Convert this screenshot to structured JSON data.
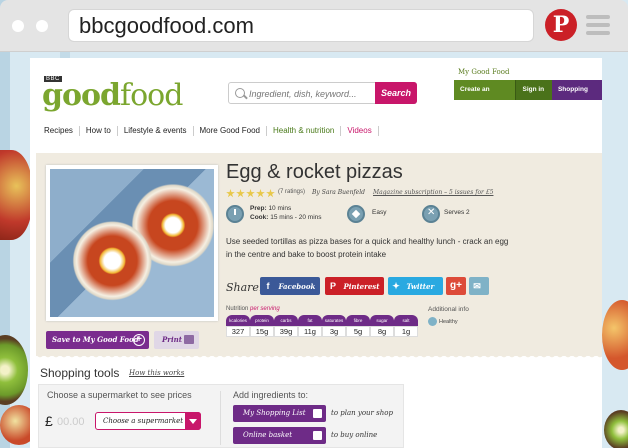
{
  "browser": {
    "url": "bbcgoodfood.com",
    "pinterest_glyph": "P"
  },
  "site": {
    "badge": "BBC",
    "logo_part1": "good",
    "logo_part2": "food",
    "search_placeholder": "Ingredient, dish, keyword...",
    "search_button": "Search",
    "my_good_food": "My Good Food",
    "create_account": "Create an account",
    "sign_in": "Sign in",
    "shopping_list": "Shopping List",
    "nav": [
      "Recipes",
      "How to",
      "Lifestyle & events",
      "More Good Food",
      "Health & nutrition",
      "Videos"
    ]
  },
  "recipe": {
    "title": "Egg & rocket pizzas",
    "ratings": "(7 ratings)",
    "author": "By Sara Buenfeld",
    "subscription": "Magazine subscription – 5 issues for £5",
    "prep_label": "Prep:",
    "prep_value": "10 mins",
    "cook_label": "Cook:",
    "cook_value": "15 mins - 20 mins",
    "skill": "Easy",
    "serves": "Serves 2",
    "description": "Use seeded tortillas as pizza bases for a quick and healthy lunch - crack an egg in the centre and bake to boost protein intake",
    "share_label": "Share:",
    "share": {
      "facebook": "Facebook",
      "pinterest": "Pinterest",
      "twitter": "Twitter",
      "googleplus": "g+"
    },
    "save_button": "Save to My Good Food",
    "print_button": "Print",
    "nutrition_label": "Nutrition",
    "nutrition_per": "per serving",
    "nutrition": [
      {
        "name": "kcalories",
        "value": "327"
      },
      {
        "name": "protein",
        "value": "15g"
      },
      {
        "name": "carbs",
        "value": "39g"
      },
      {
        "name": "fat",
        "value": "11g"
      },
      {
        "name": "saturates",
        "value": "3g"
      },
      {
        "name": "fibre",
        "value": "5g"
      },
      {
        "name": "sugar",
        "value": "8g"
      },
      {
        "name": "salt",
        "value": "1g"
      }
    ],
    "additional_info": "Additional info",
    "healthy": "Healthy"
  },
  "shopping": {
    "title": "Shopping tools",
    "how_link": "How this works",
    "choose_label": "Choose a supermarket to see prices",
    "currency": "£",
    "price": "00.00",
    "select_value": "Choose a supermarket",
    "add_label": "Add ingredients to:",
    "my_list_button": "My Shopping List",
    "plan_text": "to plan your shop",
    "online_button": "Online basket",
    "buy_text": "to buy online"
  },
  "colors": {
    "magenta": "#c8166a",
    "purple": "#6e2b87",
    "green": "#7ba62f"
  }
}
